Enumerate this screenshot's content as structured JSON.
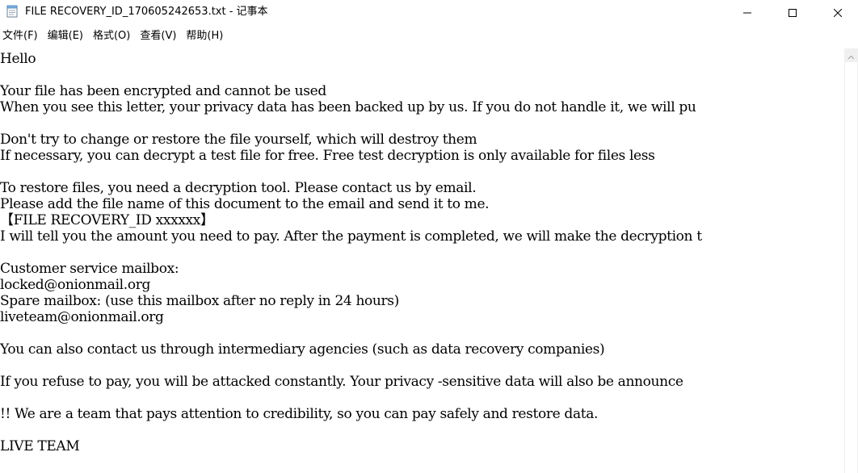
{
  "window": {
    "title": "FILE RECOVERY_ID_170605242653.txt - 记事本"
  },
  "menu": {
    "items": [
      {
        "label": "文件(F)"
      },
      {
        "label": "编辑(E)"
      },
      {
        "label": "格式(O)"
      },
      {
        "label": "查看(V)"
      },
      {
        "label": "帮助(H)"
      }
    ]
  },
  "document": {
    "content": "Hello\n\nYour file has been encrypted and cannot be used\nWhen you see this letter, your privacy data has been backed up by us. If you do not handle it, we will pu\n\nDon't try to change or restore the file yourself, which will destroy them\nIf necessary, you can decrypt a test file for free. Free test decryption is only available for files less\n\nTo restore files, you need a decryption tool. Please contact us by email.\nPlease add the file name of this document to the email and send it to me.\n【FILE RECOVERY_ID xxxxxx】\nI will tell you the amount you need to pay. After the payment is completed, we will make the decryption t\n\nCustomer service mailbox:\nlocked@onionmail.org\nSpare mailbox: (use this mailbox after no reply in 24 hours)\nliveteam@onionmail.org\n\nYou can also contact us through intermediary agencies (such as data recovery companies)\n\nIf you refuse to pay, you will be attacked constantly. Your privacy -sensitive data will also be announce\n\n!! We are a team that pays attention to credibility, so you can pay safely and restore data.\n\nLIVE TEAM"
  },
  "icons": {
    "app": "notepad-icon",
    "minimize": "minimize-icon",
    "maximize": "maximize-icon",
    "close": "close-icon",
    "scroll_up": "scroll-up-arrow-icon"
  },
  "colors": {
    "text": "#000000",
    "background": "#ffffff",
    "scrollbar_track": "#f0f0f0"
  }
}
